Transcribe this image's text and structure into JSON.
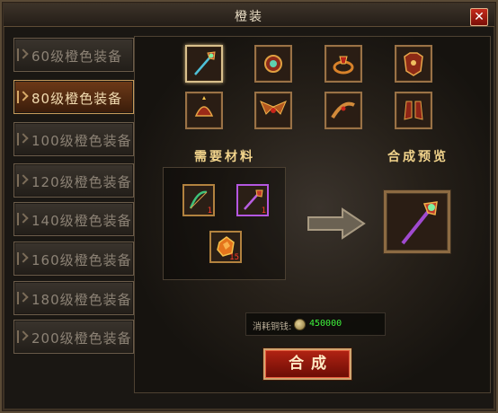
{
  "window": {
    "title": "橙装"
  },
  "sidebar": {
    "tabs": [
      {
        "label": "60级橙色装备",
        "active": false
      },
      {
        "label": "80级橙色装备",
        "active": true
      },
      {
        "label": "100级橙色装备",
        "active": false
      },
      {
        "label": "120级橙色装备",
        "active": false
      },
      {
        "label": "140级橙色装备",
        "active": false
      },
      {
        "label": "160级橙色装备",
        "active": false
      },
      {
        "label": "180级橙色装备",
        "active": false
      },
      {
        "label": "200级橙色装备",
        "active": false
      }
    ]
  },
  "equipment": {
    "items": [
      {
        "icon": "staff-icon",
        "selected": true
      },
      {
        "icon": "amulet-icon",
        "selected": false
      },
      {
        "icon": "ring-icon",
        "selected": false
      },
      {
        "icon": "armor-icon",
        "selected": false
      },
      {
        "icon": "helmet-icon",
        "selected": false
      },
      {
        "icon": "wings-icon",
        "selected": false
      },
      {
        "icon": "belt-icon",
        "selected": false
      },
      {
        "icon": "boots-icon",
        "selected": false
      }
    ]
  },
  "materials": {
    "title": "需要材料",
    "items": [
      {
        "icon": "bow-icon",
        "count": "1",
        "rarity": "orange"
      },
      {
        "icon": "staff-icon",
        "count": "1",
        "rarity": "purple"
      },
      {
        "icon": "ore-icon",
        "count": "15",
        "rarity": "orange"
      }
    ]
  },
  "preview": {
    "title": "合成预览",
    "icon": "staff-icon"
  },
  "cost": {
    "label": "消耗铜钱:",
    "value": "450000",
    "icon": "coin-icon"
  },
  "actions": {
    "craft_label": "合成"
  },
  "colors": {
    "accent": "#f2d48c",
    "cost_value": "#3ef23b",
    "button": "#b22313",
    "purple_rarity": "#b457e1"
  }
}
